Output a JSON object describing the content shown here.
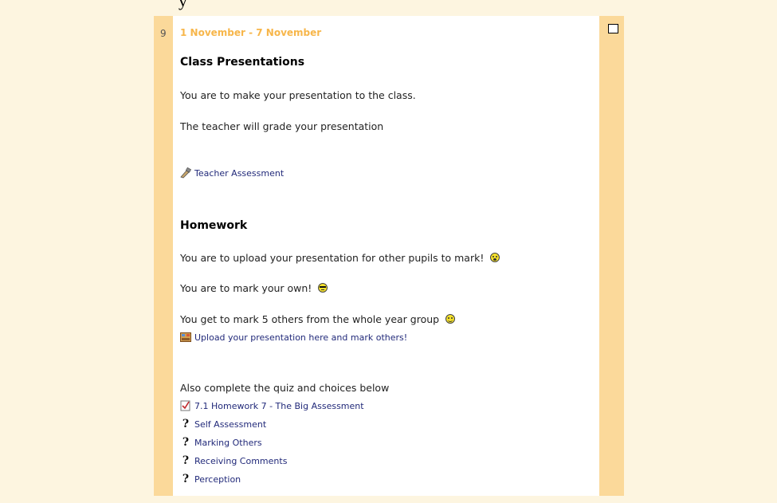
{
  "top_fragment": "y",
  "section": {
    "number": "9",
    "week_title": "1 November - 7 November",
    "class_presentations": {
      "heading": "Class Presentations",
      "line1": "You are to make your presentation to the class.",
      "line2": "The teacher will grade your presentation",
      "link": "Teacher Assessment"
    },
    "homework": {
      "heading": "Homework",
      "line1": "You are to upload your presentation for other pupils to mark!",
      "line2": "You are to mark your own!",
      "line3": "You get to mark 5 others from the whole year group",
      "upload_link": "Upload your presentation here and mark others!",
      "also": "Also complete the quiz and choices below",
      "quiz_link": "7.1 Homework 7 - The Big Assessment",
      "choices": [
        "Self Assessment",
        "Marking Others",
        "Receiving Comments",
        "Perception"
      ]
    }
  },
  "icons": {
    "assessment": "workshop-icon",
    "upload": "upload-icon",
    "quiz": "quiz-icon",
    "choice": "question-mark-icon",
    "smiley_surprise": "surprised-smiley-icon",
    "smiley_cool": "cool-smiley-icon",
    "smiley_happy": "happy-smiley-icon"
  }
}
